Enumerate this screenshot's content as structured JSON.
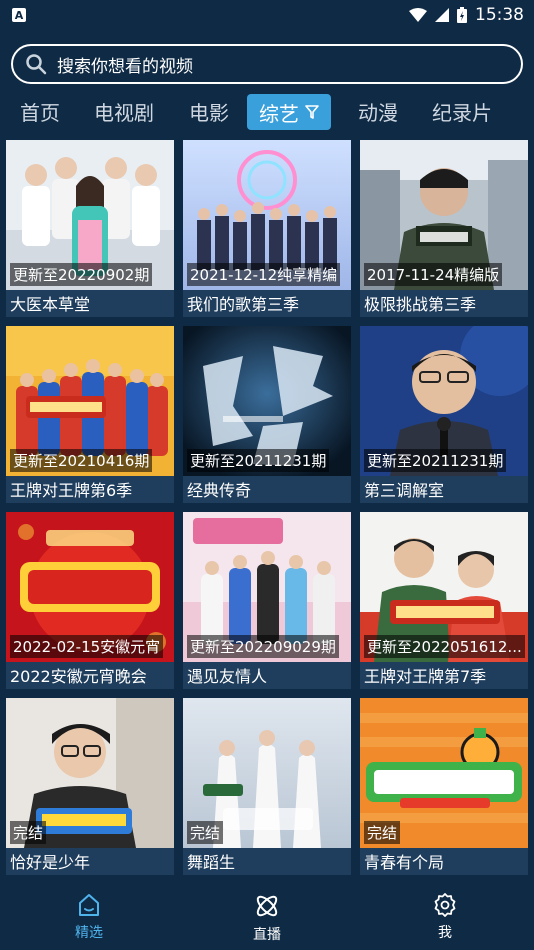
{
  "status": {
    "notif_icon_letter": "A",
    "time": "15:38"
  },
  "search": {
    "placeholder": "搜索你想看的视频"
  },
  "tabs": [
    {
      "label": "首页"
    },
    {
      "label": "电视剧"
    },
    {
      "label": "电影"
    },
    {
      "label": "综艺",
      "active": true
    },
    {
      "label": "动漫"
    },
    {
      "label": "纪录片"
    }
  ],
  "cards": [
    {
      "badge": "更新至20220902期",
      "title": "大医本草堂"
    },
    {
      "badge": "2021-12-12纯享精编",
      "title": "我们的歌第三季"
    },
    {
      "badge": "2017-11-24精编版",
      "title": "极限挑战第三季"
    },
    {
      "badge": "更新至20210416期",
      "title": "王牌对王牌第6季"
    },
    {
      "badge": "更新至20211231期",
      "title": "经典传奇"
    },
    {
      "badge": "更新至20211231期",
      "title": "第三调解室"
    },
    {
      "badge": "2022-02-15安徽元宵",
      "title": "2022安徽元宵晚会"
    },
    {
      "badge": "更新至202209029期",
      "title": "遇见友情人"
    },
    {
      "badge": "更新至2022051612...",
      "title": "王牌对王牌第7季"
    },
    {
      "badge": "完结",
      "title": "恰好是少年"
    },
    {
      "badge": "完结",
      "title": "舞蹈生"
    },
    {
      "badge": "完结",
      "title": "青春有个局"
    }
  ],
  "bottom_nav": [
    {
      "label": "精选",
      "active": true
    },
    {
      "label": "直播"
    },
    {
      "label": "我"
    }
  ],
  "colors": {
    "background": "#0f2a44",
    "accent": "#3aa0dc",
    "active_nav": "#4fb3ec"
  }
}
